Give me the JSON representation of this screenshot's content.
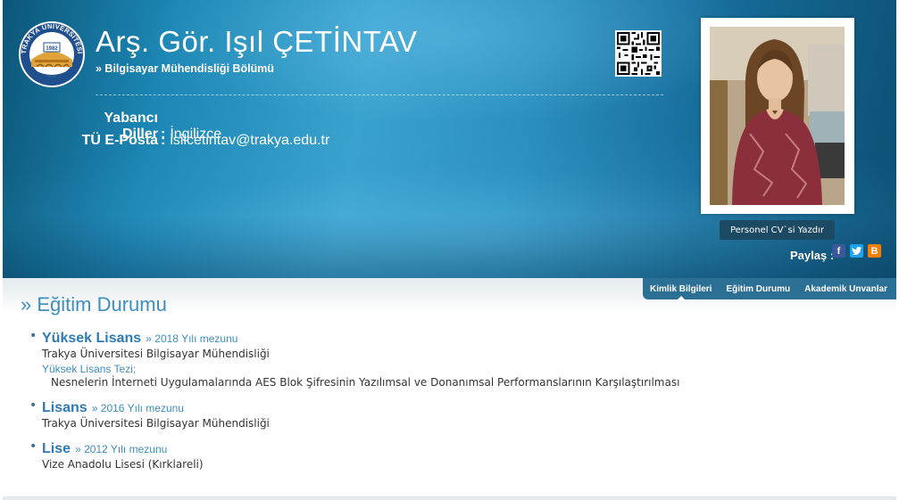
{
  "header": {
    "name": "Arş. Gör. Işıl ÇETİNTAV",
    "department": "» Bilgisayar Mühendisliği Bölümü",
    "logo": {
      "text": "TRAKYA ÜNİVERSİTESİ",
      "year": "1982"
    },
    "info": [
      {
        "label": "Yabancı Diller",
        "value": "İngilizce"
      },
      {
        "label": "TÜ E-Posta",
        "value": "isilcetintav@trakya.edu.tr"
      }
    ],
    "print_cv_label": "Personel CV`si Yazdır",
    "share_label": "Paylaş :",
    "social_icons": [
      "facebook-icon",
      "twitter-icon",
      "blogger-icon"
    ]
  },
  "tabs": [
    {
      "label": "Kimlik Bilgileri",
      "active": true
    },
    {
      "label": "Eğitim Durumu",
      "active": false
    },
    {
      "label": "Akademik Unvanlar",
      "active": false
    }
  ],
  "section_title": "» Eğitim Durumu",
  "education": [
    {
      "degree": "Yüksek Lisans",
      "year": "» 2018 Yılı mezunu",
      "school": "Trakya Üniversitesi Bilgisayar Mühendisliği",
      "thesis_label": "Yüksek Lisans Tezi;",
      "thesis": "Nesnelerin İnterneti Uygulamalarında AES Blok Şifresinin Yazılımsal ve Donanımsal Performanslarının Karşılaştırılması"
    },
    {
      "degree": "Lisans",
      "year": "» 2016 Yılı mezunu",
      "school": "Trakya Üniversitesi Bilgisayar Mühendisliği"
    },
    {
      "degree": "Lise",
      "year": "» 2012 Yılı mezunu",
      "school": "Vize Anadolu Lisesi (Kırklareli)"
    }
  ],
  "colors": {
    "accent": "#3f8ec0",
    "tab_bar": "#2c6f95",
    "facebook": "#3b5998",
    "twitter": "#1da1f2",
    "blogger": "#f57d00"
  }
}
